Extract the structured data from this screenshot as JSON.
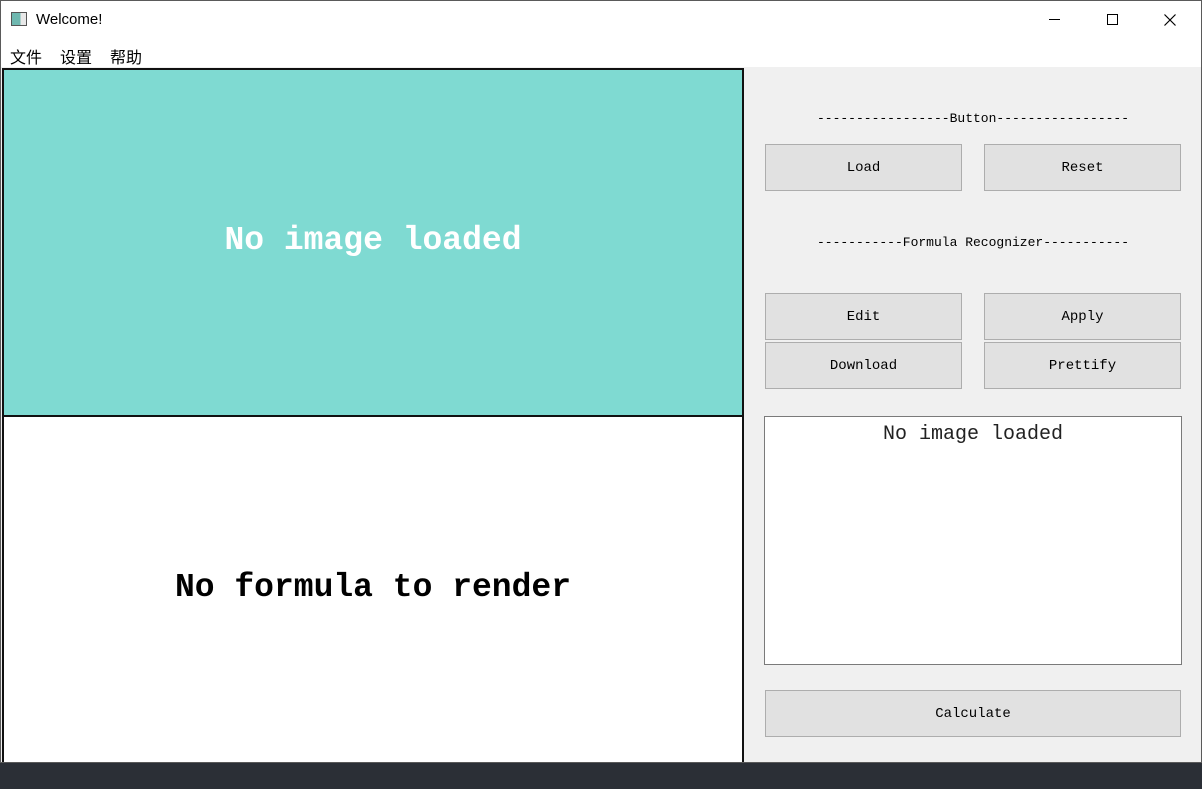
{
  "window": {
    "title": "Welcome!",
    "controls": {
      "minimize": "minimize",
      "maximize": "maximize",
      "close": "✕"
    }
  },
  "menu": {
    "items": [
      {
        "label": "文件"
      },
      {
        "label": "设置"
      },
      {
        "label": "帮助"
      }
    ]
  },
  "image_panel": {
    "placeholder": "No image loaded",
    "background": "#7fdad2"
  },
  "formula_panel": {
    "placeholder": "No formula to render"
  },
  "button_section": {
    "label": "-----------------Button-----------------",
    "load": "Load",
    "reset": "Reset"
  },
  "recognizer_section": {
    "label": "-----------Formula Recognizer-----------",
    "edit": "Edit",
    "apply": "Apply",
    "download": "Download",
    "prettify": "Prettify"
  },
  "output": {
    "text": "No image loaded"
  },
  "calculate": {
    "label": "Calculate"
  },
  "icons": {
    "app": "app-window-icon",
    "minimize": "minimize-icon",
    "maximize": "maximize-icon",
    "close": "close-icon"
  }
}
